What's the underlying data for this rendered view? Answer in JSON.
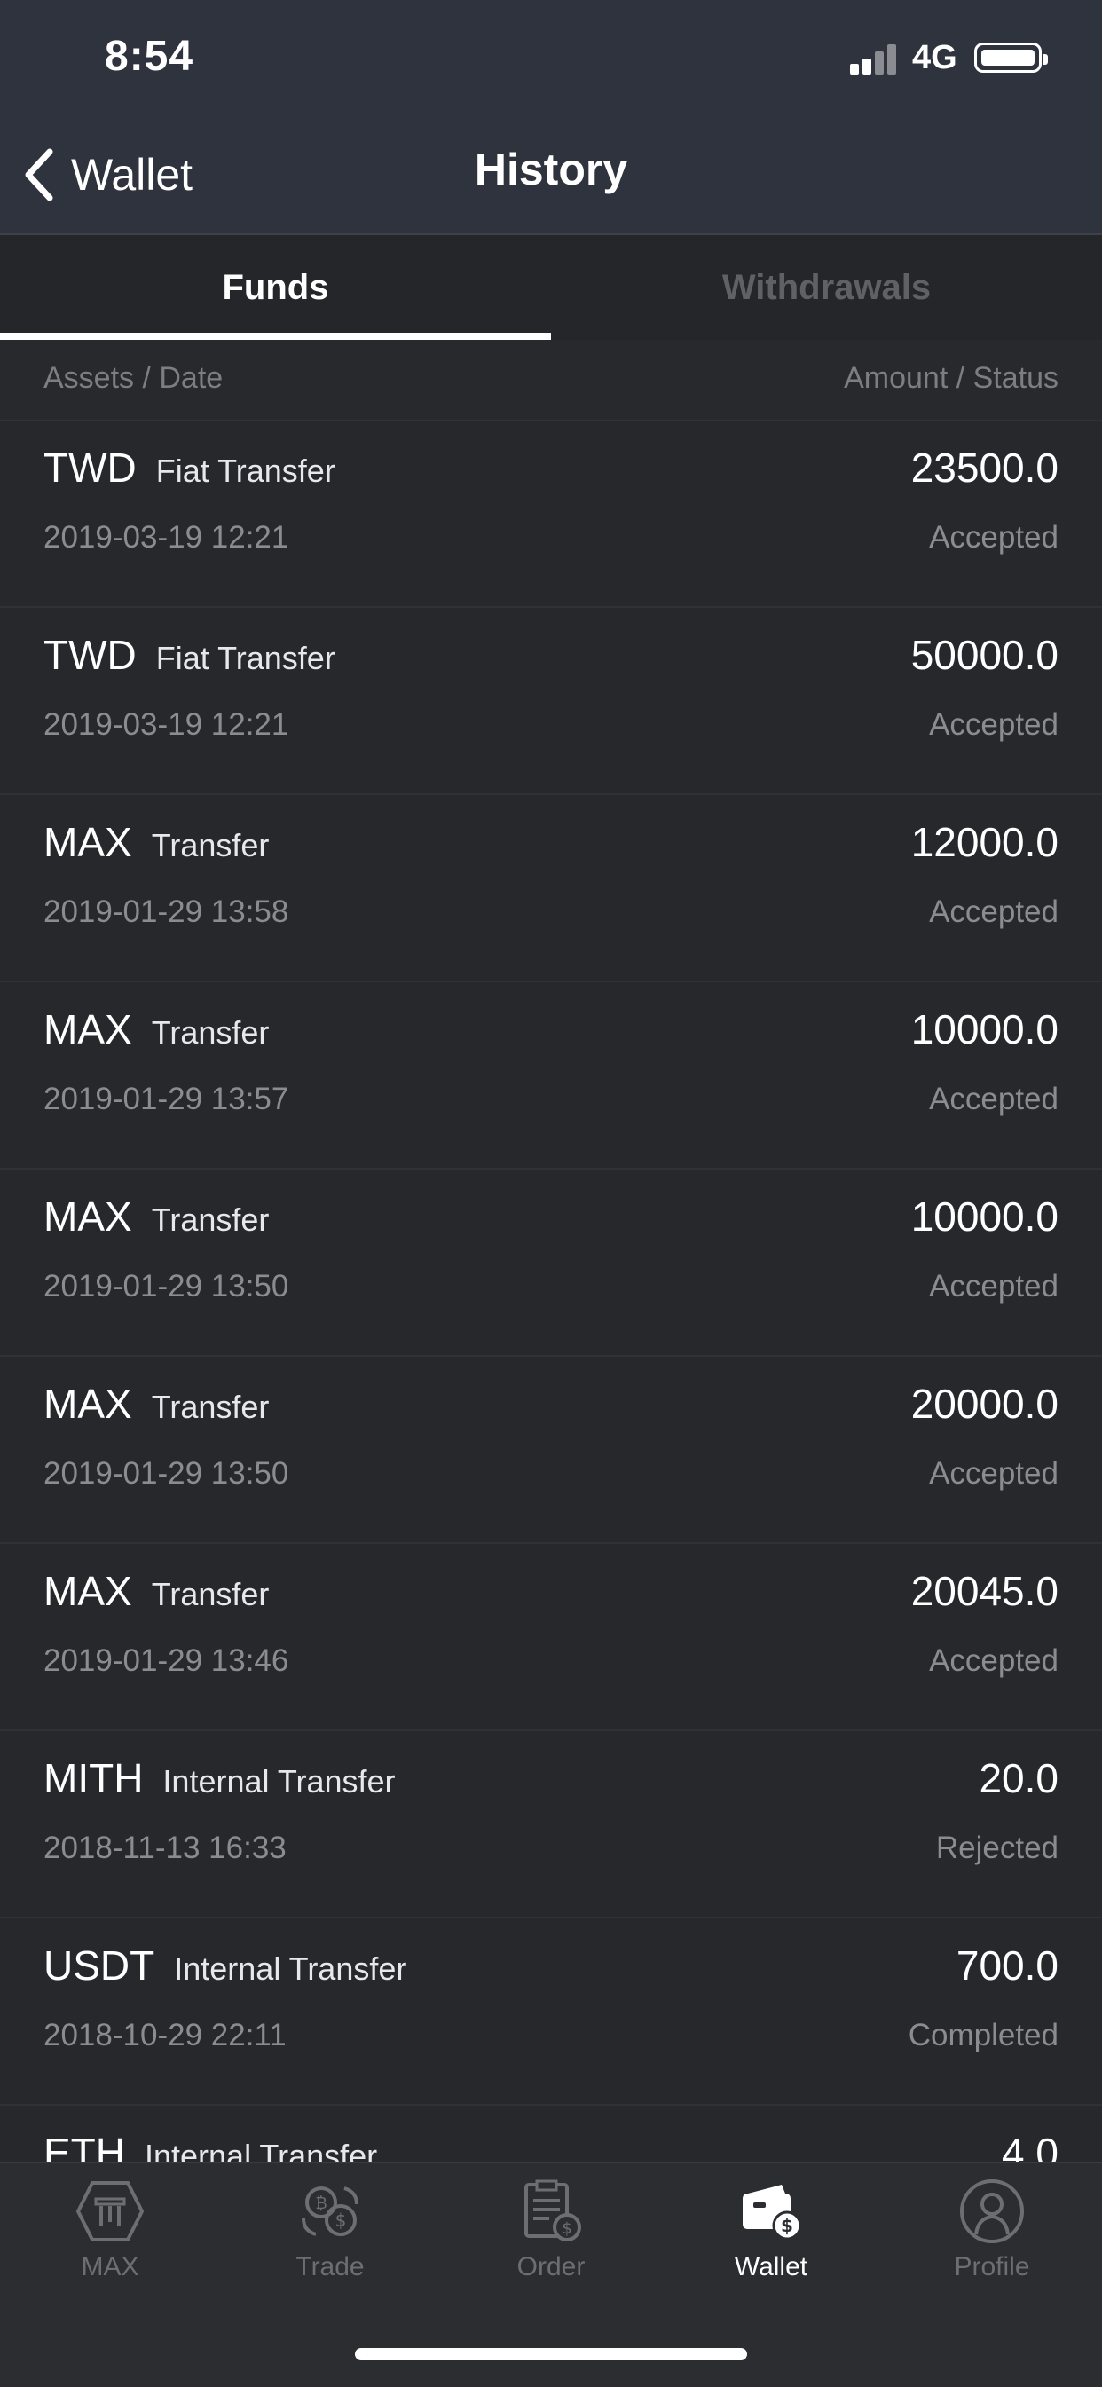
{
  "status_bar": {
    "time": "8:54",
    "network": "4G"
  },
  "nav": {
    "back_label": "Wallet",
    "title": "History"
  },
  "tabs": [
    {
      "label": "Funds",
      "active": true
    },
    {
      "label": "Withdrawals",
      "active": false
    }
  ],
  "columns": {
    "left": "Assets / Date",
    "right": "Amount / Status"
  },
  "rows": [
    {
      "asset": "TWD",
      "type": "Fiat Transfer",
      "amount": "23500.0",
      "date": "2019-03-19 12:21",
      "status": "Accepted"
    },
    {
      "asset": "TWD",
      "type": "Fiat Transfer",
      "amount": "50000.0",
      "date": "2019-03-19 12:21",
      "status": "Accepted"
    },
    {
      "asset": "MAX",
      "type": "Transfer",
      "amount": "12000.0",
      "date": "2019-01-29 13:58",
      "status": "Accepted"
    },
    {
      "asset": "MAX",
      "type": "Transfer",
      "amount": "10000.0",
      "date": "2019-01-29 13:57",
      "status": "Accepted"
    },
    {
      "asset": "MAX",
      "type": "Transfer",
      "amount": "10000.0",
      "date": "2019-01-29 13:50",
      "status": "Accepted"
    },
    {
      "asset": "MAX",
      "type": "Transfer",
      "amount": "20000.0",
      "date": "2019-01-29 13:50",
      "status": "Accepted"
    },
    {
      "asset": "MAX",
      "type": "Transfer",
      "amount": "20045.0",
      "date": "2019-01-29 13:46",
      "status": "Accepted"
    },
    {
      "asset": "MITH",
      "type": "Internal Transfer",
      "amount": "20.0",
      "date": "2018-11-13 16:33",
      "status": "Rejected"
    },
    {
      "asset": "USDT",
      "type": "Internal Transfer",
      "amount": "700.0",
      "date": "2018-10-29 22:11",
      "status": "Completed"
    },
    {
      "asset": "ETH",
      "type": "Internal Transfer",
      "amount": "4.0",
      "date": "",
      "status": ""
    }
  ],
  "bottom_nav": [
    {
      "label": "MAX",
      "icon": "max-logo-icon",
      "active": false
    },
    {
      "label": "Trade",
      "icon": "trade-exchange-icon",
      "active": false
    },
    {
      "label": "Order",
      "icon": "order-clipboard-icon",
      "active": false
    },
    {
      "label": "Wallet",
      "icon": "wallet-icon",
      "active": true
    },
    {
      "label": "Profile",
      "icon": "profile-icon",
      "active": false
    }
  ],
  "colors": {
    "background": "#27282b",
    "header": "#2f333d",
    "muted_text": "#8a8c91",
    "inactive_tab": "#5f6167"
  }
}
